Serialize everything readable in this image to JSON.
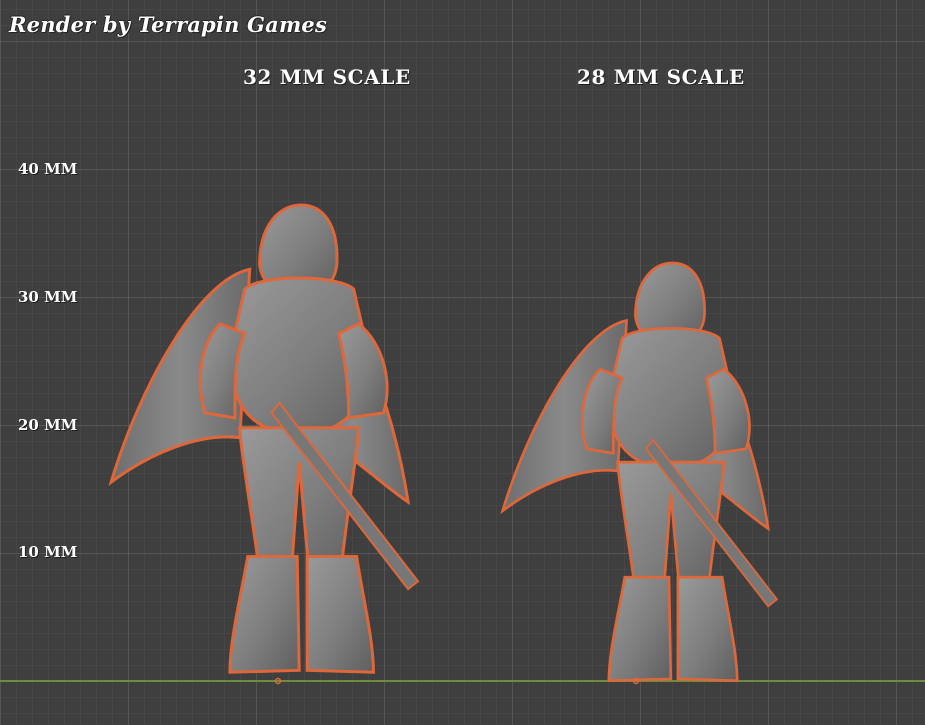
{
  "credit": "Render by Terrapin Games",
  "scales": {
    "left": "32 MM SCALE",
    "right": "28 MM SCALE"
  },
  "ruler": [
    "40 MM",
    "30 MM",
    "20 MM",
    "10 MM"
  ],
  "colors": {
    "background": "#3f3f3f",
    "figure": "#8a8a8a",
    "outline": "#e0673a",
    "ground": "#6f8c3e"
  }
}
